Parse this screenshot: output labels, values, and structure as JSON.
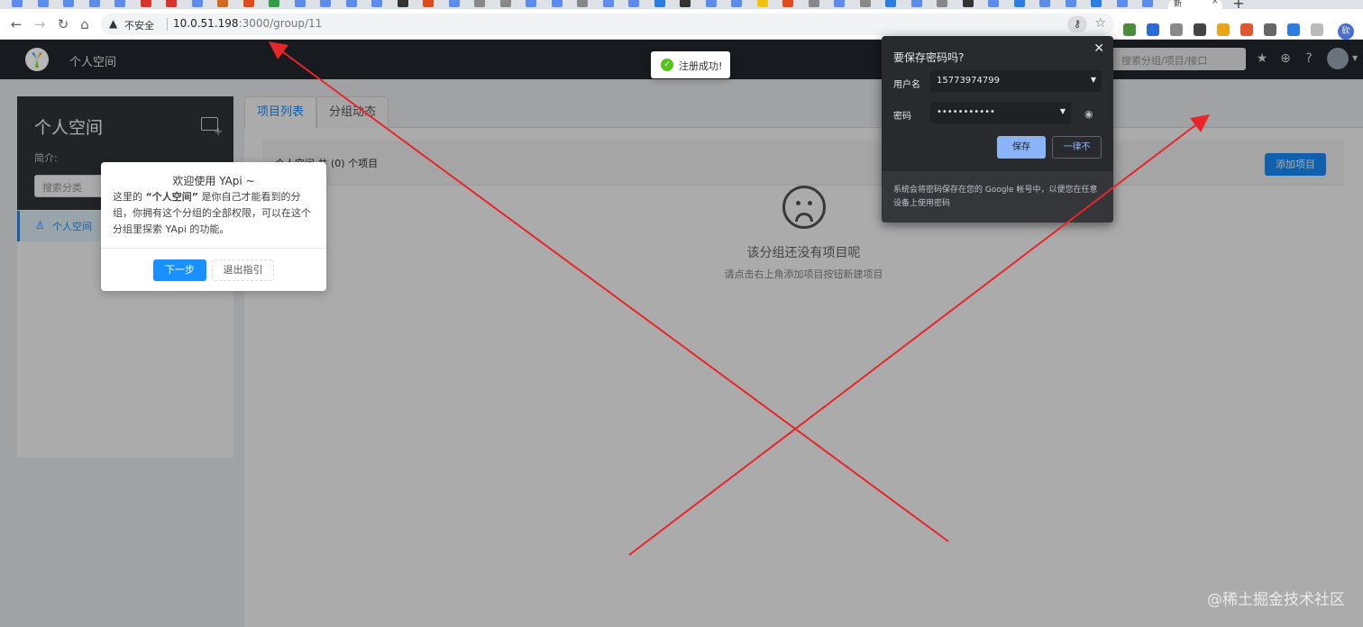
{
  "browser": {
    "active_tab_title": "新",
    "address_security": "不安全",
    "url_host": "10.0.51.198",
    "url_rest": ":3000/group/11",
    "new_tab_symbol": "+",
    "tab_favicons": [
      "#5b8def",
      "#5b8def",
      "#5b8def",
      "#5b8def",
      "#5b8def",
      "#d9342b",
      "#d9342b",
      "#5b8def",
      "#d2691e",
      "#e04b1a",
      "#2f9e44",
      "#5b8def",
      "#5b8def",
      "#5b8def",
      "#5b8def",
      "#333333",
      "#e04b1a",
      "#5b8def",
      "#888888",
      "#888888",
      "#5b8def",
      "#5b8def",
      "#888888",
      "#5b8def",
      "#5b8def",
      "#2a7de1",
      "#333333",
      "#5b8def",
      "#5b8def",
      "#f1c40f",
      "#e04b1a",
      "#888888",
      "#5b8def",
      "#888888",
      "#2a7de1",
      "#5b8def",
      "#888888",
      "#333333",
      "#5b8def",
      "#2a7de1",
      "#5b8def",
      "#5b8def",
      "#2a7de1",
      "#5b8def",
      "#5b8def"
    ],
    "extension_icons": [
      {
        "name": "translate-ext-icon",
        "color": "#4b8b3b"
      },
      {
        "name": "puzzle-ext-icon",
        "color": "#2a6ad9"
      },
      {
        "name": "vue-ext-icon",
        "color": "#8a8a8a"
      },
      {
        "name": "x-ext-icon",
        "color": "#444444"
      },
      {
        "name": "chrome-ext-icon",
        "color": "#e8a317"
      },
      {
        "name": "share-ext-icon",
        "color": "#e0582b"
      },
      {
        "name": "code-ext-icon",
        "color": "#666666"
      },
      {
        "name": "block-ext-icon",
        "color": "#2a7de1"
      },
      {
        "name": "cloud-ext-icon",
        "color": "#bbbbbb"
      }
    ],
    "profile_label": "砍"
  },
  "header": {
    "title": "个人空间",
    "search_placeholder": "搜索分组/项目/接口"
  },
  "sidebar": {
    "space_name": "个人空间",
    "desc_label": "简介:",
    "search_placeholder": "搜索分类",
    "menu_item": "个人空间"
  },
  "tabs": [
    "项目列表",
    "分组动态"
  ],
  "main": {
    "info_text": "个人空间 共 (0) 个项目",
    "add_project": "添加项目",
    "empty_title": "该分组还没有项目呢",
    "empty_desc": "请点击右上角添加项目按钮新建项目"
  },
  "toast": {
    "message": "注册成功!"
  },
  "guide": {
    "title": "欢迎使用 YApi ~",
    "body_prefix": "这里的",
    "body_bold": "“个人空间”",
    "body_suffix": "是你自己才能看到的分组，你拥有这个分组的全部权限，可以在这个分组里探索 YApi 的功能。",
    "next": "下一步",
    "quit": "退出指引"
  },
  "password_dialog": {
    "title": "要保存密码吗?",
    "username_label": "用户名",
    "username_value": "15773974799",
    "password_label": "密码",
    "password_value": "•••••••••••",
    "save": "保存",
    "never": "一律不",
    "footer": "系统会将密码保存在您的 Google 帐号中，以便您在任意设备上使用密码"
  },
  "watermark": "@稀土掘金技术社区",
  "colors": {
    "annotation": "#e8262a",
    "primary": "#1890ff",
    "header_bg": "#1f2329"
  }
}
